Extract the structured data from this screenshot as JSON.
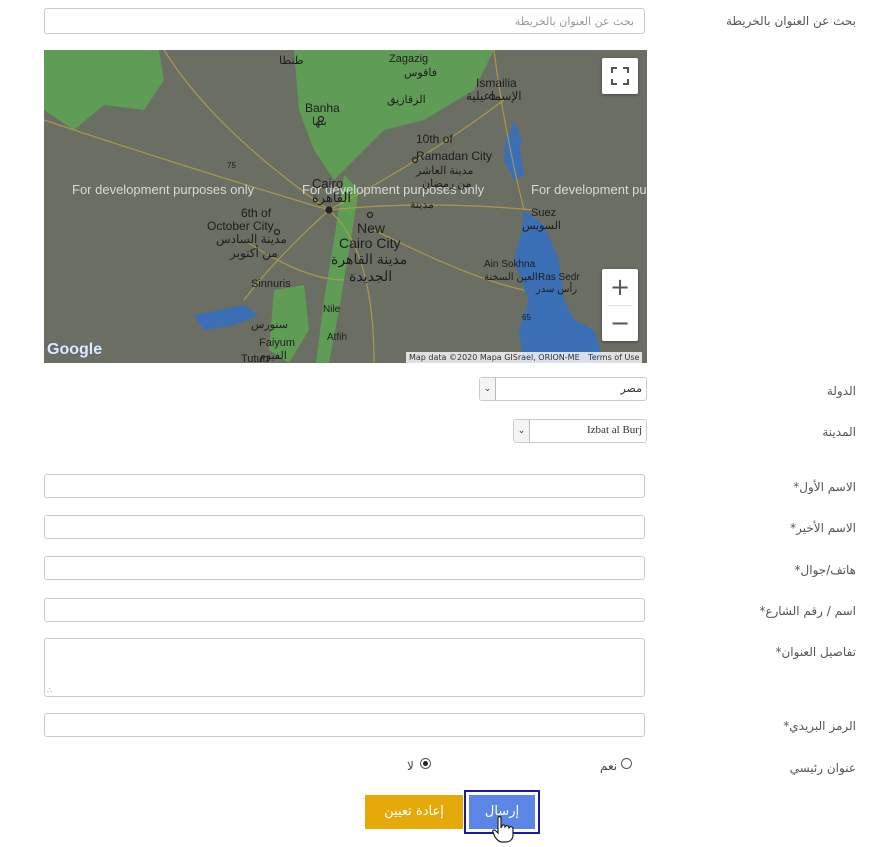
{
  "search": {
    "label": "بحث عن العنوان بالخريطة",
    "placeholder": "بحث عن العنوان بالخريطة"
  },
  "map": {
    "watermark": "For development purposes only",
    "attribution": "Map data ©2020 Mapa GISrael, ORION-ME",
    "terms": "Terms of Use",
    "logo": "Google",
    "zoom_in": "+",
    "zoom_out": "−",
    "places": {
      "tanta": "طنطا",
      "zagazig": "Zagazig",
      "zagazig_ar": "الزقازيق",
      "faqous": "فاقوس",
      "ismailia": "Ismailia",
      "ismailia_ar": "الإسماعيلية",
      "banha": "Banha",
      "banha_ar": "بنها",
      "ramadan1": "10th of",
      "ramadan2": "Ramadan City",
      "ramadan3": "مدينة العاشر",
      "ramadan4": "من رمضان",
      "ramadan5": "مدينة",
      "cairo": "Cairo",
      "cairo_ar": "القاهرة",
      "suez": "Suez",
      "suez_ar": "السويس",
      "october1": "6th of",
      "october2": "October City",
      "october3": "مدينة السادس",
      "october4": "من أكتوبر",
      "newcairo1": "New",
      "newcairo2": "Cairo City",
      "newcairo3": "مدينة القاهرة",
      "newcairo4": "الجديدة",
      "sokhna1": "Ain Sokhna",
      "sokhna2": "العين السخنة",
      "rassedr1": "Ras Sedr",
      "rassedr2": "رأس سدر",
      "sinnuris1": "Sinnuris",
      "sinnuris2": "سنورس",
      "faiyum1": "Faiyum",
      "faiyum2": "الفيوم",
      "tutun": "Tutun",
      "atfih": "Atfih",
      "nile": "Nile",
      "road75": "75",
      "road65": "65"
    }
  },
  "country": {
    "label": "الدولة",
    "value": "مصر"
  },
  "city": {
    "label": "المدينة",
    "value": "Izbat al Burj"
  },
  "fields": {
    "first_name": "الاسم الأول*",
    "last_name": "الاسم الأخير*",
    "phone": "هاتف/جوال*",
    "street": "اسم / رقم الشارع*",
    "details": "تفاصيل العنوان*",
    "postal": "الرمز البريدي*"
  },
  "primary_address": {
    "label": "عنوان رئيسي",
    "yes": "نعم",
    "no": "لا",
    "selected": "no"
  },
  "buttons": {
    "reset": "إعادة تعيين",
    "submit": "إرسال"
  },
  "colors": {
    "submit": "#5b86e5",
    "reset": "#e5a90a",
    "focus_border": "#1a1aa6"
  }
}
